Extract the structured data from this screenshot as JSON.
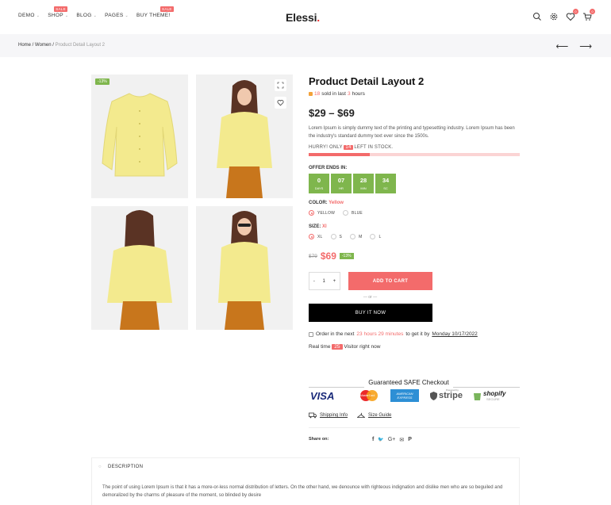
{
  "header": {
    "nav": [
      {
        "label": "DEMO",
        "caret": true,
        "badge": ""
      },
      {
        "label": "SHOP",
        "caret": true,
        "badge": "SALE"
      },
      {
        "label": "BLOG",
        "caret": true,
        "badge": ""
      },
      {
        "label": "PAGES",
        "caret": true,
        "badge": ""
      },
      {
        "label": "BUY THEME!",
        "caret": false,
        "badge": "SALE"
      }
    ],
    "logo": "Elessi",
    "logo_dot": ".",
    "wishlist_count": "0",
    "cart_count": "0"
  },
  "breadcrumb": {
    "home": "Home",
    "sep1": " / ",
    "women": "Women",
    "sep2": " / ",
    "current": "Product Detail Layout 2",
    "prev_arrow": "⟵",
    "next_arrow": "⟶"
  },
  "gallery": {
    "sale_tag": "-13%"
  },
  "product": {
    "title": "Product Detail Layout 2",
    "sold_count": "18",
    "sold_mid": "sold in last",
    "sold_hours": "3",
    "sold_suffix": "hours",
    "price_range": "$29 – $69",
    "description": "Lorem Ipsum is simply dummy text of the printing and typesetting industry. Lorem Ipsum has been the industry's standard dummy text ever since the 1500s.",
    "hurry_prefix": "HURRY! ONLY",
    "hurry_num": "14",
    "hurry_suffix": "LEFT IN STOCK.",
    "stock_fill": 0.29,
    "offer_label": "OFFER ENDS IN:",
    "countdown": [
      {
        "num": "0",
        "label": "DAYS"
      },
      {
        "num": "07",
        "label": "HR"
      },
      {
        "num": "28",
        "label": "MIN"
      },
      {
        "num": "34",
        "label": "SC"
      }
    ],
    "color_label": "COLOR:",
    "color_value": "Yellow",
    "colors": [
      "YELLOW",
      "BLUE"
    ],
    "size_label": "SIZE:",
    "size_value": "Xl",
    "sizes": [
      "XL",
      "S",
      "M",
      "L"
    ],
    "old_price": "$79",
    "new_price": "$69",
    "discount": "-13%",
    "qty": "1",
    "qty_minus": "-",
    "qty_plus": "+",
    "add_to_cart": "ADD TO CART",
    "or": "— or —",
    "buy_now": "BUY IT NOW",
    "order_prefix": "Order in the next",
    "order_time": "23 hours 29 minutes",
    "order_mid": "to get it by",
    "order_date": "Monday 10/17/2022",
    "realtime_prefix": "Real time",
    "realtime_num": "25",
    "realtime_suffix": "Visitor right now"
  },
  "secure": {
    "title": "Guaranteed SAFE Checkout",
    "visa": "VISA",
    "mastercard": "MasterCard",
    "amex": "AMERICAN EXPRESS",
    "stripe": "stripe",
    "stripe_pre": "Powered by",
    "shopify": "shopify",
    "shopify_sub": "SECURE"
  },
  "links": {
    "shipping": "Shipping Info",
    "size_guide": "Size Guide"
  },
  "share": {
    "label": "Share on:",
    "icons": [
      "f",
      "🐦",
      "G+",
      "✉",
      "P"
    ]
  },
  "description_tab": {
    "title": "DESCRIPTION",
    "text": "The point of using Lorem Ipsum is that it has a more-or-less normal distribution of letters. On the other hand, we denounce with righteous indignation and dislike men who are so beguiled and demoralized by the charms of pleasure of the moment, so blinded by desire"
  },
  "colors": {
    "accent": "#f36b6b",
    "green": "#7fb64d",
    "sweater": "#f3ea8e",
    "pants": "#c8761c"
  }
}
